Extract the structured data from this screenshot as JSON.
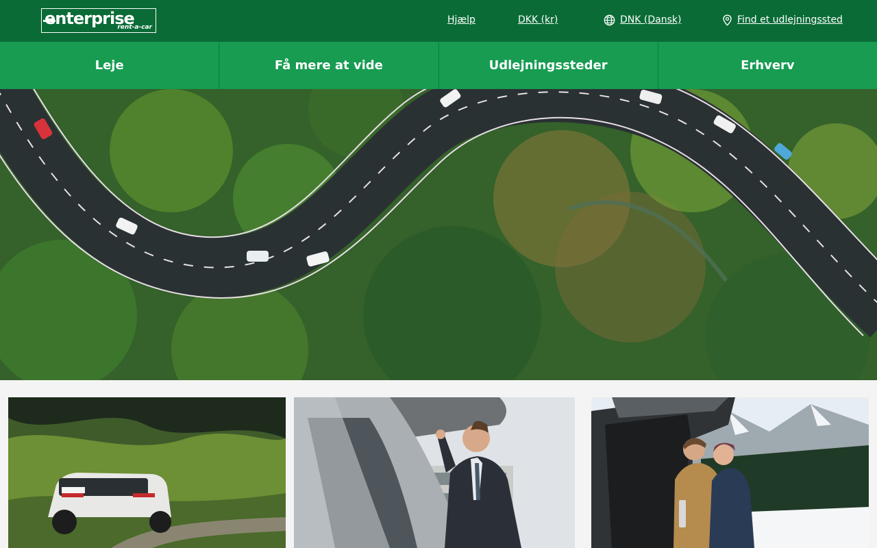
{
  "header": {
    "logo": {
      "brand": "enterprise",
      "tagline": "rent-a-car"
    },
    "links": {
      "help": "Hjælp",
      "currency": "DKK (kr)",
      "language": "DNK (Dansk)",
      "find_location": "Find et udlejningssted"
    },
    "icons": {
      "language": "globe-icon",
      "find_location": "location-pin-icon"
    }
  },
  "nav": {
    "items": [
      {
        "label": "Leje"
      },
      {
        "label": "Få mere at vide"
      },
      {
        "label": "Udlejningssteder"
      },
      {
        "label": "Erhverv"
      }
    ]
  },
  "hero": {
    "image": "aerial view of winding road through green forest"
  },
  "cards": [
    {
      "image": "white SUV parked on mountain road"
    },
    {
      "image": "businessman loading car trunk"
    },
    {
      "image": "couple sitting in open car trunk in snowy landscape"
    }
  ],
  "colors": {
    "topbar": "#0a6b36",
    "nav": "#179c52",
    "page_bg": "#f4f4f4"
  }
}
